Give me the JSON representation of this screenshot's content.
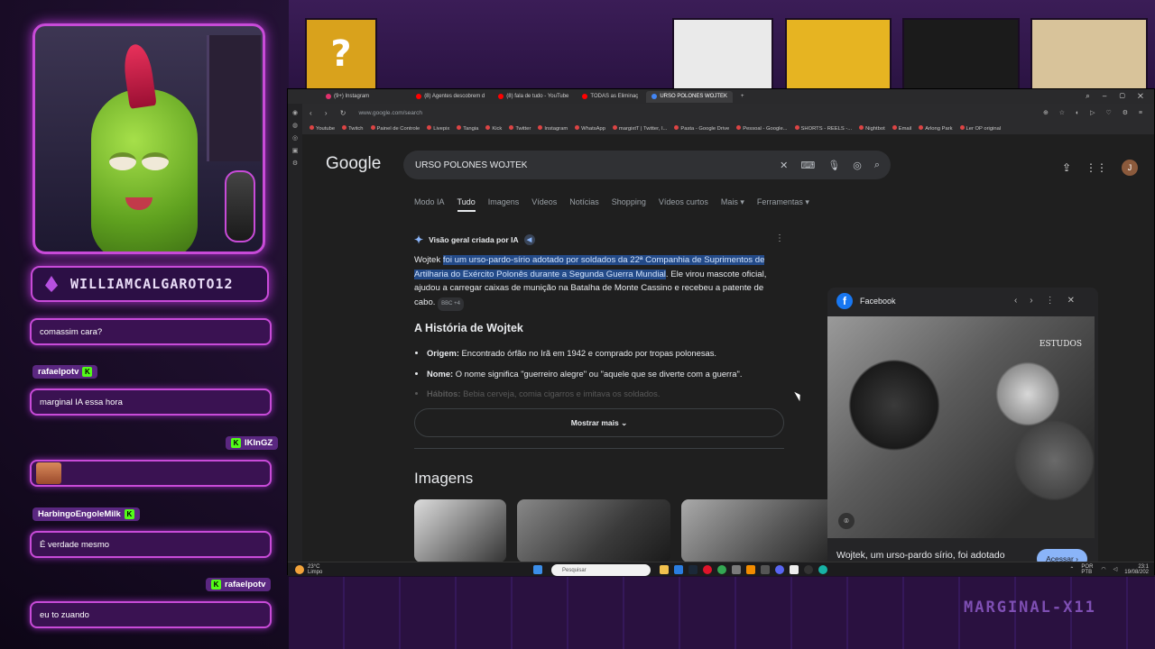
{
  "stream": {
    "streamer_name": "WILLIAMCALGAROTO12",
    "watermark": "MARGINAL-X11",
    "chat": [
      {
        "user": "",
        "text": "comassim cara?"
      },
      {
        "user": "rafaelpotv",
        "text": "marginal IA essa hora"
      },
      {
        "user": "lKInGZ",
        "text": ""
      },
      {
        "user": "HarbingoEngoleMilk",
        "text": "É verdade mesmo"
      },
      {
        "user": "rafaelpotv",
        "text": "eu to zuando"
      }
    ]
  },
  "browser": {
    "tabs": [
      "(9+) Instagram",
      "(8) Agentes descobrem d",
      "(8) fala de tudo - YouTube",
      "TODAS as Eliminaç",
      "URSO POLONES WOJTEK"
    ],
    "url": "www.google.com/search",
    "bookmarks": [
      "Youtube",
      "Twitch",
      "Painel de Controle",
      "Livepix",
      "Tangia",
      "Kick",
      "Twitter",
      "Instagram",
      "WhatsApp",
      "margixtT | Twitter, I...",
      "Pasta - Google Drive",
      "Pessoal - Google...",
      "SHORTS - REELS -...",
      "Nightbot",
      "Email",
      "Arlong Park",
      "Ler OP original"
    ]
  },
  "google": {
    "logo": "Google",
    "query": "URSO POLONES WOJTEK",
    "nav_tabs": [
      "Modo IA",
      "Tudo",
      "Imagens",
      "Vídeos",
      "Notícias",
      "Shopping",
      "Vídeos curtos",
      "Mais ▾",
      "Ferramentas ▾"
    ],
    "ai_overview": {
      "heading": "Visão geral criada por IA",
      "lead": "Wojtek ",
      "highlight": "foi um urso-pardo-sírio adotado por soldados da 22ª Companhia de Suprimentos de Artilharia do Exército Polonês durante a Segunda Guerra Mundial",
      "rest": ". Ele virou mascote oficial, ajudou a carregar caixas de munição na Batalha de Monte Cassino e recebeu a patente de cabo.",
      "source": "BBC +4",
      "subheading": "A História de Wojtek",
      "bullets": [
        {
          "label": "Origem:",
          "text": " Encontrado órfão no Irã em 1942 e comprado por tropas polonesas."
        },
        {
          "label": "Nome:",
          "text": " O nome significa \"guerreiro alegre\" ou \"aquele que se diverte com a guerra\"."
        },
        {
          "label": "Hábitos:",
          "text": " Bebia cerveja, comia cigarros e imitava os soldados."
        }
      ],
      "show_more": "Mostrar mais"
    },
    "images_title": "Imagens",
    "side_panel": {
      "source": "Facebook",
      "photo_watermark": "ESTUDOS",
      "caption": "Wojtek, um urso-pardo sírio, foi adotado pelo II Corpo de Exército...",
      "button": "Acessar ›"
    }
  },
  "taskbar": {
    "temperature": "23°C",
    "weather": "Limpo",
    "search_placeholder": "Pesquisar",
    "lang": "POR PTB",
    "time": "23:1",
    "date": "19/08/202"
  }
}
